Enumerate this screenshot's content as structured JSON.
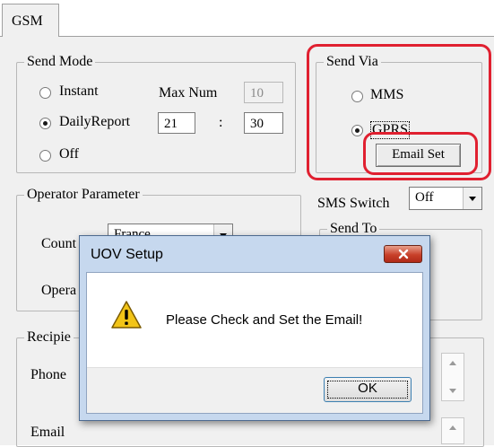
{
  "tab": {
    "label": "GSM"
  },
  "send_mode": {
    "legend": "Send Mode",
    "instant_label": "Instant",
    "daily_label": "DailyReport",
    "off_label": "Off",
    "selected": "DailyReport",
    "max_num_label": "Max Num",
    "max_num_value": "10",
    "hour_value": "21",
    "minute_value": "30",
    "time_separator": ":"
  },
  "send_via": {
    "legend": "Send Via",
    "mms_label": "MMS",
    "gprs_label": "GPRS",
    "selected": "GPRS",
    "email_set_label": "Email Set"
  },
  "operator": {
    "legend": "Operator Parameter",
    "country_label": "Count",
    "country_value": "France",
    "operator_label": "Opera"
  },
  "sms_switch": {
    "label": "SMS Switch",
    "value": "Off"
  },
  "send_to": {
    "legend": "Send To"
  },
  "recipient": {
    "legend": "Recipie",
    "phone_label": "Phone",
    "email_label": "Email"
  },
  "dialog": {
    "title": "UOV Setup",
    "message": "Please Check and Set the Email!",
    "ok_label": "OK"
  },
  "colors": {
    "highlight": "#e02030",
    "dialog_frame": "#c6d8ee",
    "warning": "#f2c417"
  }
}
